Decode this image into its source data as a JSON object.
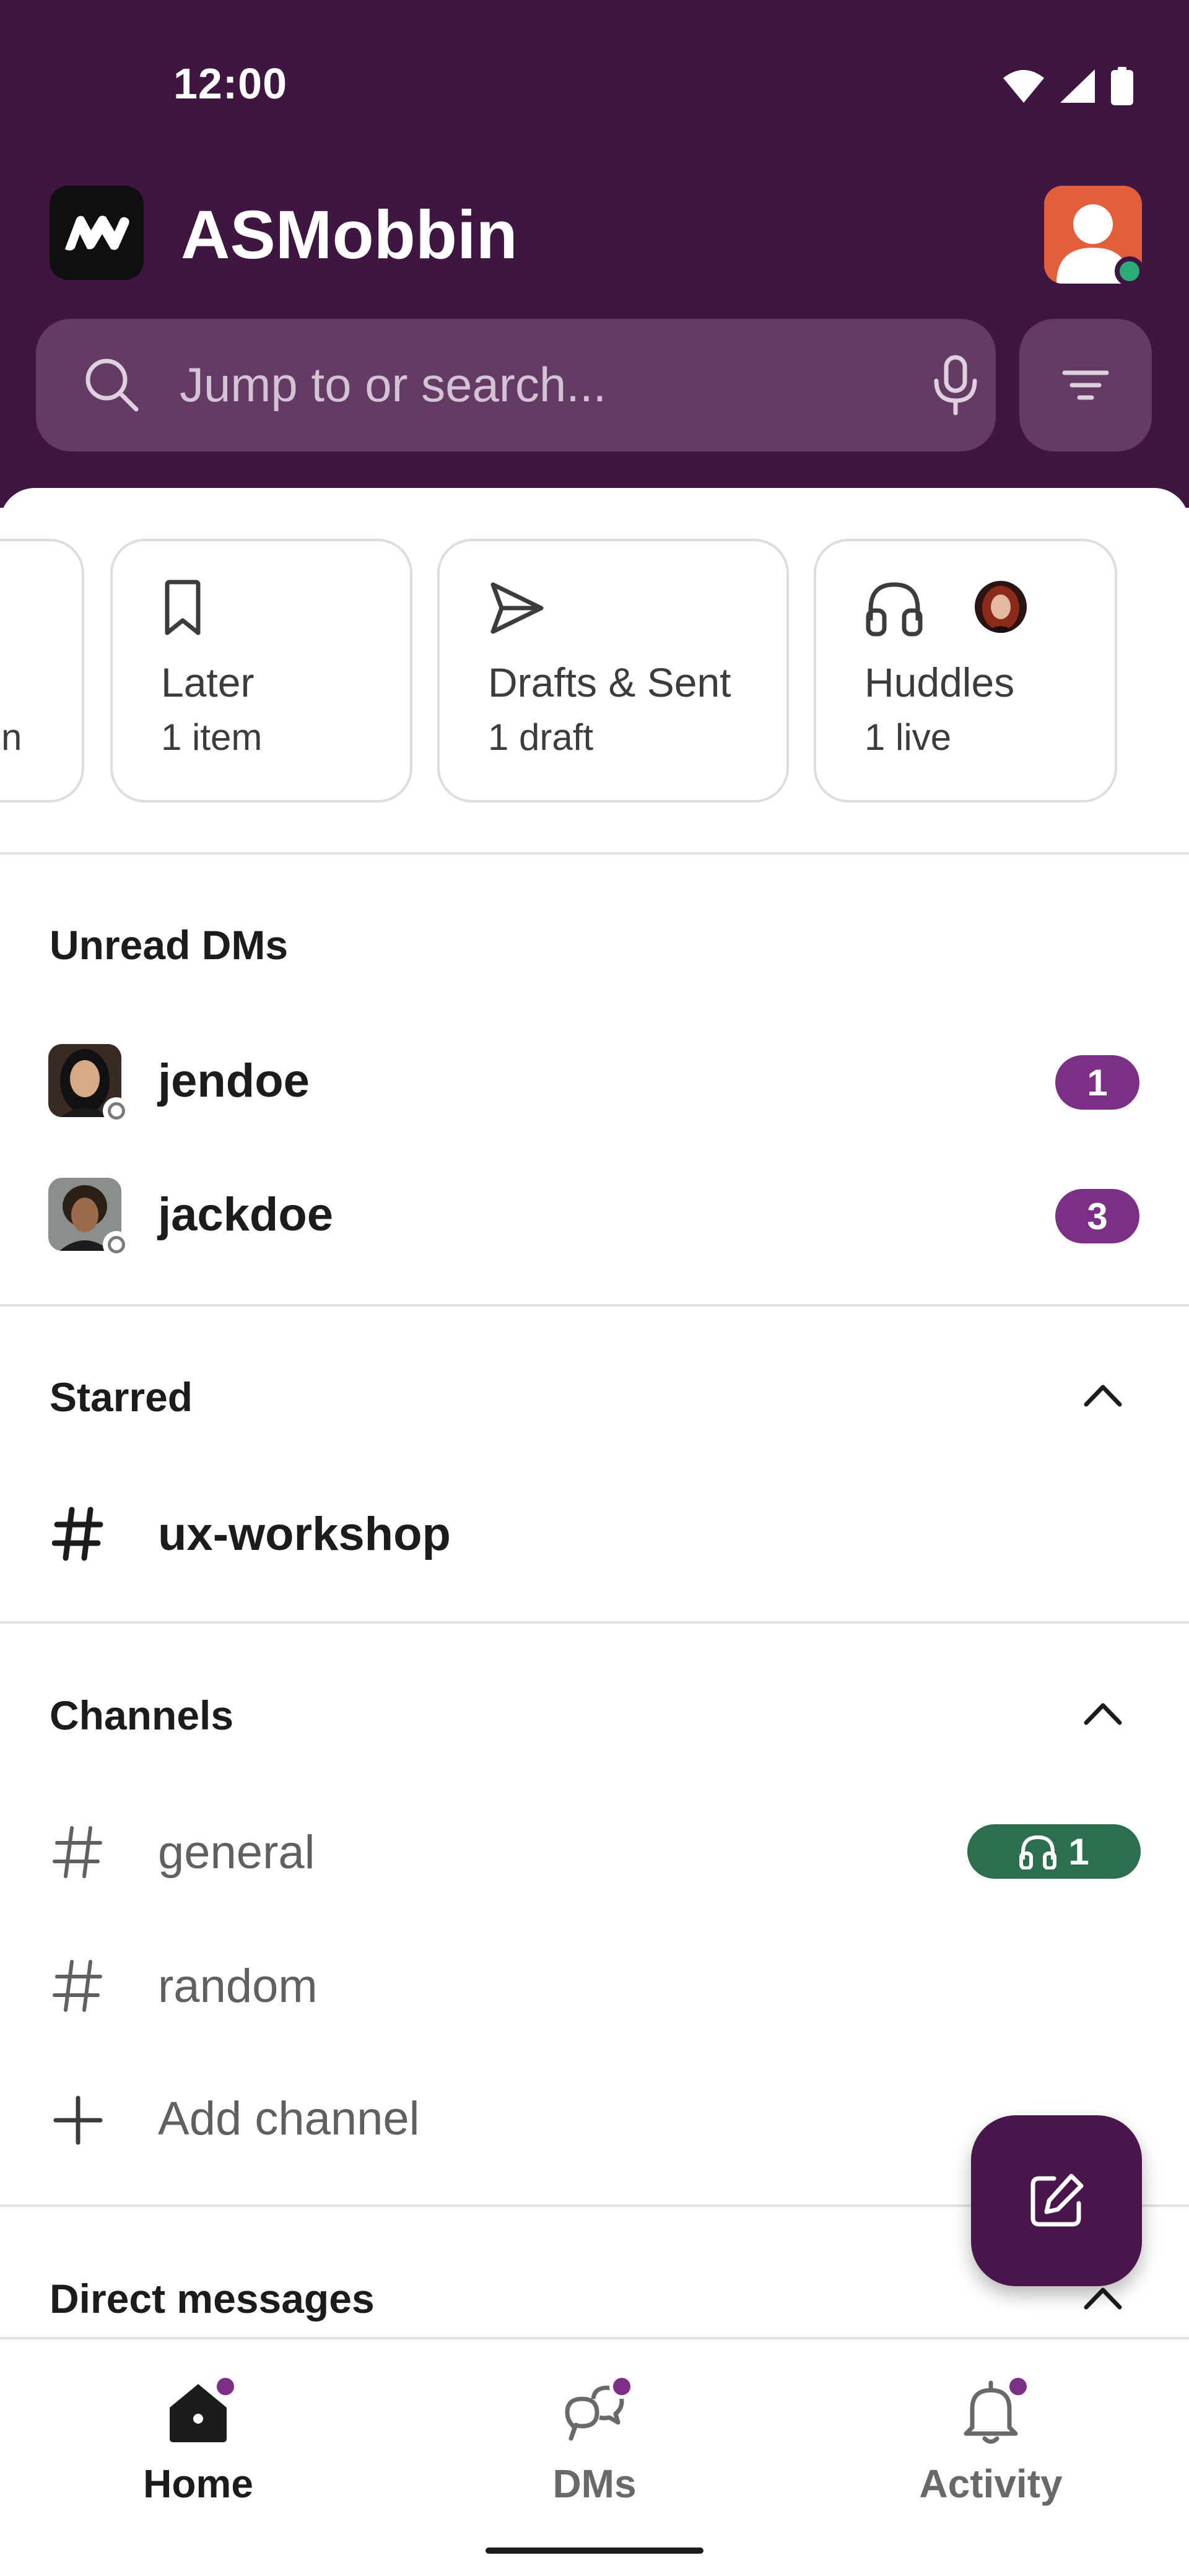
{
  "status_bar": {
    "time": "12:00",
    "icons": [
      "wifi-icon",
      "cellular-signal-icon",
      "battery-icon"
    ]
  },
  "header": {
    "workspace_name": "ASMobbin",
    "workspace_logo": "workspace-logo-icon",
    "search": {
      "placeholder": "Jump to or search...",
      "value": ""
    }
  },
  "quick_cards": [
    {
      "icon": "bookmark-icon",
      "title": "Later",
      "subtitle": "1 item"
    },
    {
      "icon": "send-icon",
      "title": "Drafts & Sent",
      "subtitle": "1 draft"
    },
    {
      "icon": "headphones-icon",
      "title": "Huddles",
      "subtitle": "1 live"
    }
  ],
  "partial_card_fragment": "n",
  "unread_dms": {
    "title": "Unread DMs",
    "items": [
      {
        "name": "jendoe",
        "count": "1"
      },
      {
        "name": "jackdoe",
        "count": "3"
      }
    ]
  },
  "starred": {
    "title": "Starred",
    "items": [
      {
        "name": "ux-workshop"
      }
    ]
  },
  "channels": {
    "title": "Channels",
    "items": [
      {
        "name": "general",
        "huddle_count": "1"
      },
      {
        "name": "random"
      }
    ],
    "add_label": "Add channel"
  },
  "direct_messages": {
    "title": "Direct messages"
  },
  "bottom_nav": {
    "items": [
      {
        "label": "Home",
        "icon": "home-icon",
        "active": true
      },
      {
        "label": "DMs",
        "icon": "dms-icon",
        "active": false
      },
      {
        "label": "Activity",
        "icon": "bell-icon",
        "active": false
      }
    ]
  },
  "colors": {
    "header_bg": "#3f1541",
    "badge": "#7c3085",
    "huddle_badge": "#2c6e4e",
    "fab": "#4a154b",
    "presence": "#2bac76"
  }
}
